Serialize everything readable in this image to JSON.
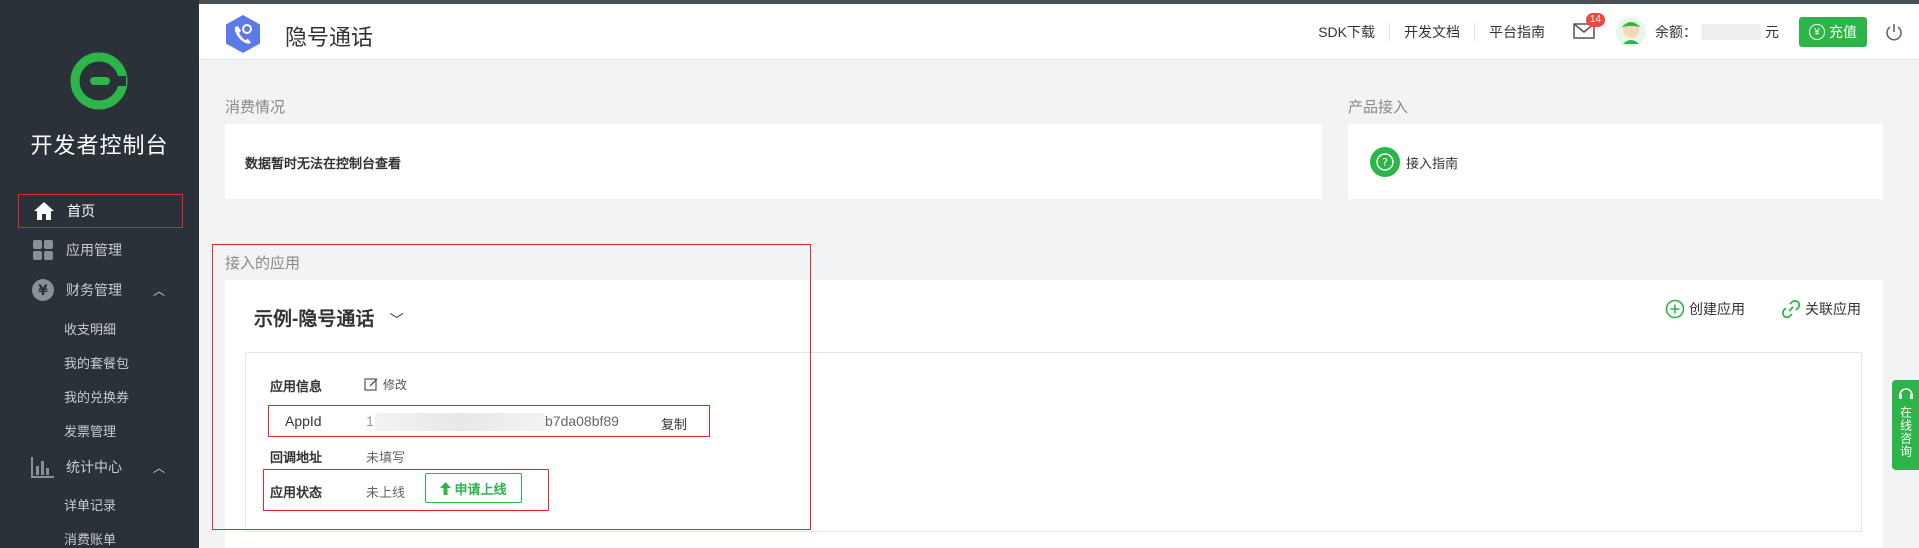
{
  "sidebar": {
    "brand": "开发者控制台",
    "items": [
      {
        "label": "首页"
      },
      {
        "label": "应用管理"
      },
      {
        "label": "财务管理"
      },
      {
        "label": "统计中心"
      }
    ],
    "finance_sub": [
      "收支明细",
      "我的套餐包",
      "我的兑换券",
      "发票管理"
    ],
    "stats_sub": [
      "详单记录",
      "消费账单"
    ]
  },
  "header": {
    "title": "隐号通话",
    "links": [
      "SDK下载",
      "开发文档",
      "平台指南"
    ],
    "mail_badge": "14",
    "balance_label": "余额：",
    "balance_unit": "元",
    "recharge_label": "充值",
    "recharge_icon": "¥"
  },
  "consumption": {
    "section_label": "消费情况",
    "message": "数据暂时无法在控制台查看"
  },
  "product": {
    "section_label": "产品接入",
    "guide_label": "接入指南",
    "guide_icon": "?"
  },
  "apps": {
    "section_label": "接入的应用",
    "current_app": "示例-隐号通话",
    "create_label": "创建应用",
    "link_label": "关联应用",
    "info_label": "应用信息",
    "edit_label": "修改",
    "appid_label": "AppId",
    "appid_prefix": "1",
    "appid_suffix": "b7da08bf89",
    "copy_label": "复制",
    "callback_label": "回调地址",
    "callback_value": "未填写",
    "status_label": "应用状态",
    "status_value": "未上线",
    "apply_label": "申请上线"
  },
  "chat_tab": {
    "label": "在线咨询"
  },
  "colors": {
    "accent": "#2db54a",
    "sidebar_bg": "#2b3138",
    "highlight_frame": "#e5262a",
    "badge": "#f0473f"
  }
}
